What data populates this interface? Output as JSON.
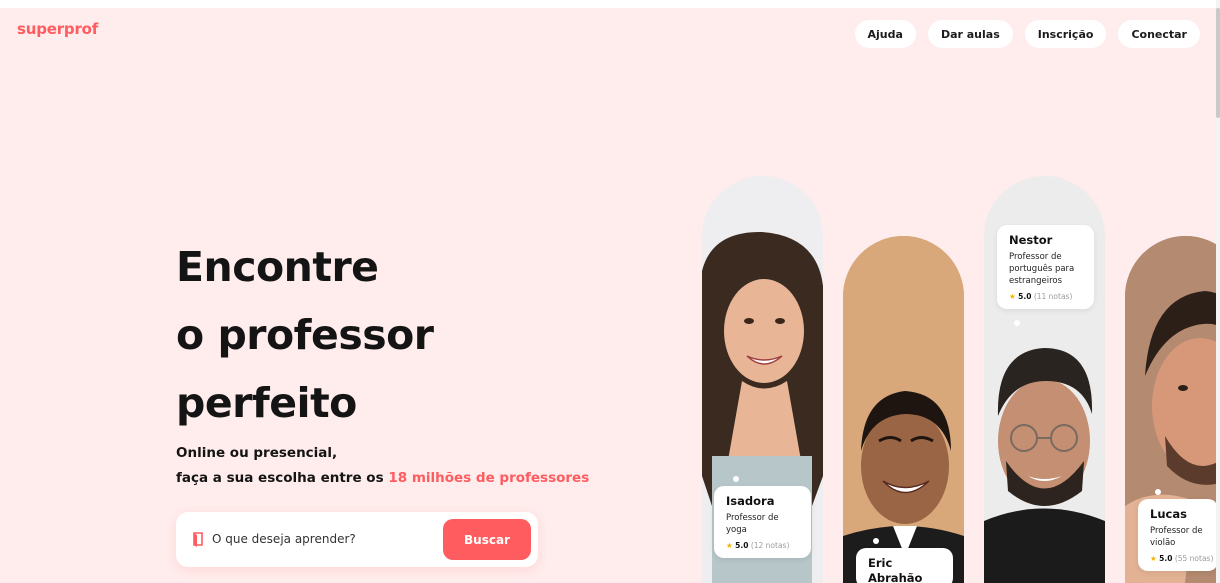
{
  "brand": {
    "logo": "superprof",
    "accent": "#ff5c60",
    "background": "#ffecec"
  },
  "nav": {
    "items": [
      {
        "label": "Ajuda"
      },
      {
        "label": "Dar aulas"
      },
      {
        "label": "Inscrição"
      },
      {
        "label": "Conectar"
      }
    ]
  },
  "hero": {
    "title_lines": [
      "Encontre",
      "o professor",
      "perfeito"
    ],
    "subtitle_line1": "Online ou presencial,",
    "subtitle_line2_prefix": "faça a sua escolha entre os ",
    "subtitle_line2_highlight": "18 milhões de professores"
  },
  "search": {
    "placeholder": "O que deseja aprender?",
    "button_label": "Buscar",
    "icon": "book-icon"
  },
  "tutors": [
    {
      "name": "Isadora",
      "subject": "Professor de yoga",
      "rating": "5.0",
      "reviews": "(12 notas)"
    },
    {
      "name": "Eric Abrahão",
      "subject": "",
      "rating": "",
      "reviews": ""
    },
    {
      "name": "Nestor",
      "subject": "Professor de português para estrangeiros",
      "rating": "5.0",
      "reviews": "(11 notas)"
    },
    {
      "name": "Lucas",
      "subject": "Professor de violão",
      "rating": "5.0",
      "reviews": "(55 notas)"
    }
  ]
}
